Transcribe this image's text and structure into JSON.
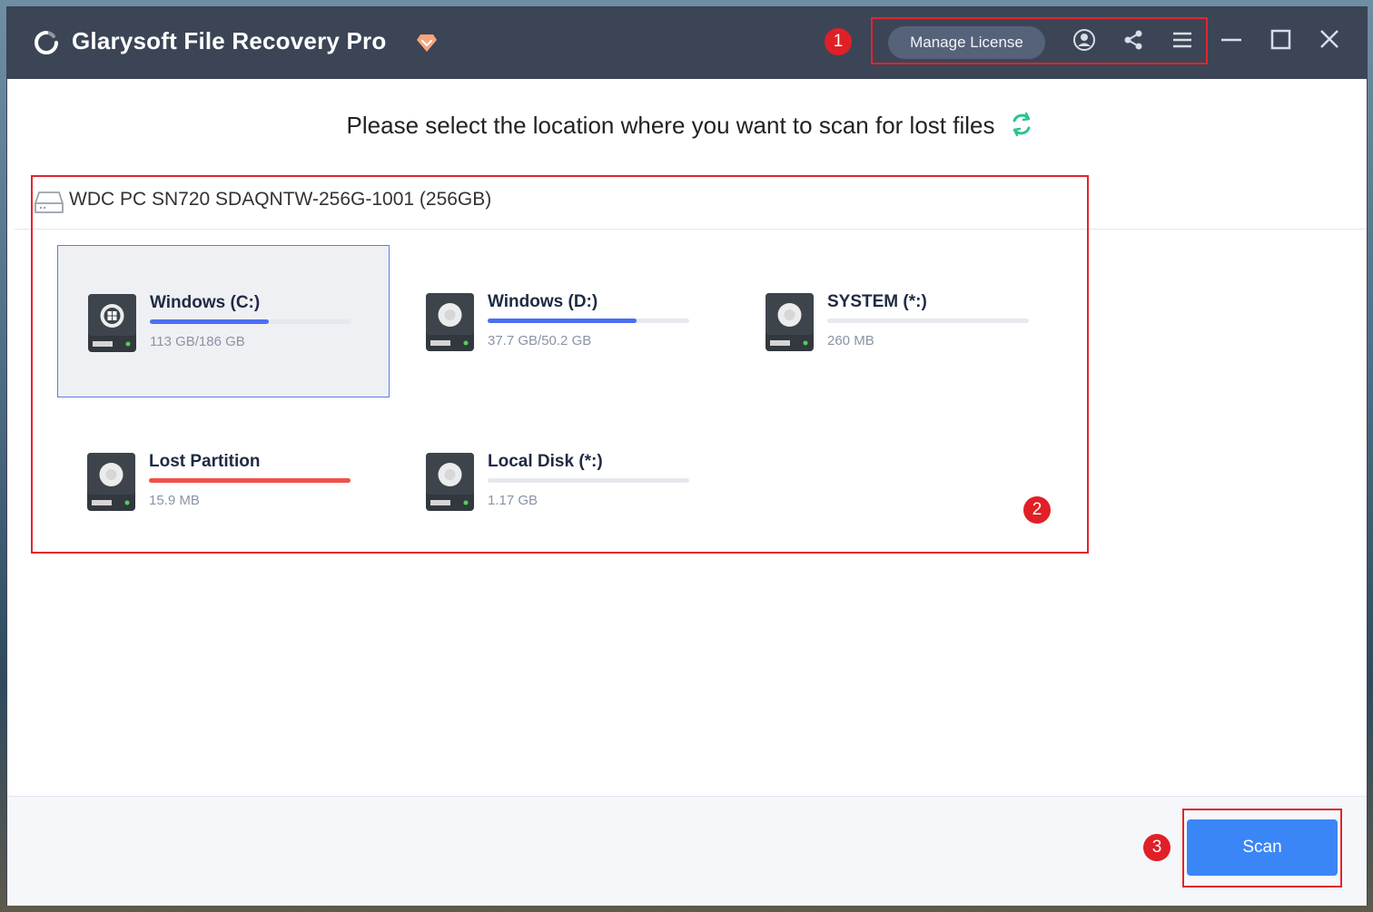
{
  "app": {
    "title": "Glarysoft File Recovery Pro"
  },
  "header": {
    "manage_license": "Manage License"
  },
  "callouts": {
    "one": "1",
    "two": "2",
    "three": "3"
  },
  "main": {
    "prompt": "Please select the location where you want to scan for lost files",
    "disk": {
      "name": "WDC PC SN720 SDAQNTW-256G-1001 (256GB)"
    },
    "partitions": [
      {
        "name": "Windows (C:)",
        "size": "113 GB/186 GB",
        "used_fraction": 0.59,
        "bar_color": "#4b6ff4",
        "selected": true,
        "icon": "windows-drive-icon"
      },
      {
        "name": "Windows (D:)",
        "size": "37.7 GB/50.2 GB",
        "used_fraction": 0.74,
        "bar_color": "#4b6ff4",
        "selected": false,
        "icon": "hard-drive-icon"
      },
      {
        "name": "SYSTEM (*:)",
        "size": "260 MB",
        "used_fraction": 0,
        "bar_color": "#4b6ff4",
        "selected": false,
        "icon": "hard-drive-icon"
      },
      {
        "name": "Lost Partition",
        "size": "15.9 MB",
        "used_fraction": 1.0,
        "bar_color": "#f0514a",
        "selected": false,
        "icon": "hard-drive-icon"
      },
      {
        "name": "Local Disk (*:)",
        "size": "1.17 GB",
        "used_fraction": 0,
        "bar_color": "#4b6ff4",
        "selected": false,
        "icon": "hard-drive-icon"
      }
    ]
  },
  "footer": {
    "scan_label": "Scan"
  },
  "colors": {
    "titlebar": "#3b4556",
    "accent": "#3b86f6",
    "highlight": "#e2252c",
    "refresh": "#2bc38f"
  }
}
